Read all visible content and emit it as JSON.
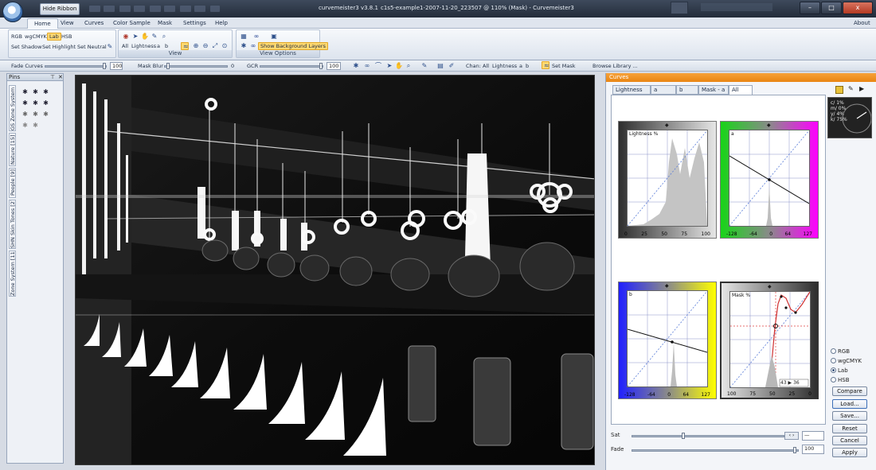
{
  "titlebar": {
    "hide_ribbon": "Hide Ribbon",
    "app_version": "curvemeister3 v3.8.1",
    "document_title": "c1s5-example1-2007-11-20_223507 @ 110% (Mask) - Curvemeister3",
    "min_symbol": "–",
    "max_symbol": "□",
    "close_symbol": "x"
  },
  "ribbon_tabs": [
    "Home",
    "View",
    "Curves",
    "Color Sample",
    "Mask",
    "Settings",
    "Help"
  ],
  "about_label": "About",
  "color_spaces": [
    "RGB",
    "wgCMYK",
    "Lab",
    "HSB"
  ],
  "buttons": {
    "set_shadow": "Set Shadow",
    "set_highlight": "Set Highlight",
    "set_neutral": "Set Neutral",
    "channels": [
      "All",
      "Lightness",
      "a",
      "b"
    ],
    "view_group": "View",
    "show_bg_layers": "Show Background Layers",
    "view_options": "View Options"
  },
  "toolbar": {
    "fade_curves": "Fade Curves",
    "fade_value": "100",
    "mask_blur": "Mask Blur",
    "mask_blur_value": "0",
    "gcr": "GCR",
    "gcr_value": "100",
    "chan_label": "Chan:",
    "chan_items": [
      "All",
      "Lightness",
      "a",
      "b"
    ],
    "set_mask": "Set Mask",
    "browse_library": "Browse Library ..."
  },
  "pins": {
    "title": "Pins",
    "tabs": [
      "GS Zone System [11]",
      "Nature [15]",
      "People [9]",
      "SHN Skin Tones [27]",
      "Zone System [11]"
    ]
  },
  "curves": {
    "panel_title": "Curves",
    "tabs": [
      "Lightness",
      "a",
      "b",
      "Mask - a",
      "All"
    ],
    "plots": [
      {
        "label": "Lightness %",
        "ticks": [
          "0",
          "25",
          "50",
          "75",
          "100"
        ],
        "frame_color": "#5a5a5a"
      },
      {
        "label": "a",
        "ticks": [
          "-128",
          "-64",
          "0",
          "64",
          "127"
        ],
        "frame_color": "#ff00ff"
      },
      {
        "label": "b",
        "ticks": [
          "-128",
          "-64",
          "0",
          "64",
          "127"
        ],
        "frame_color": "#ffff00"
      },
      {
        "label": "Mask %",
        "ticks": [
          "100",
          "75",
          "50",
          "25",
          "0"
        ],
        "frame_color": "#4a4a4a"
      }
    ],
    "mask_readout": "43 ▶ 36",
    "color_radios": [
      "RGB",
      "wgCMYK",
      "Lab",
      "HSB"
    ],
    "selected_space": "Lab",
    "action_buttons": [
      "Compare",
      "Load...",
      "Save...",
      "Reset",
      "Cancel",
      "Apply"
    ],
    "cmyk_readout": [
      "c/ 1%",
      "m/ 0%",
      "y/ 4%",
      "k/ 75%"
    ],
    "sat_label": "Sat",
    "sat_value": "—",
    "fade_label": "Fade",
    "fade_value": "100"
  }
}
